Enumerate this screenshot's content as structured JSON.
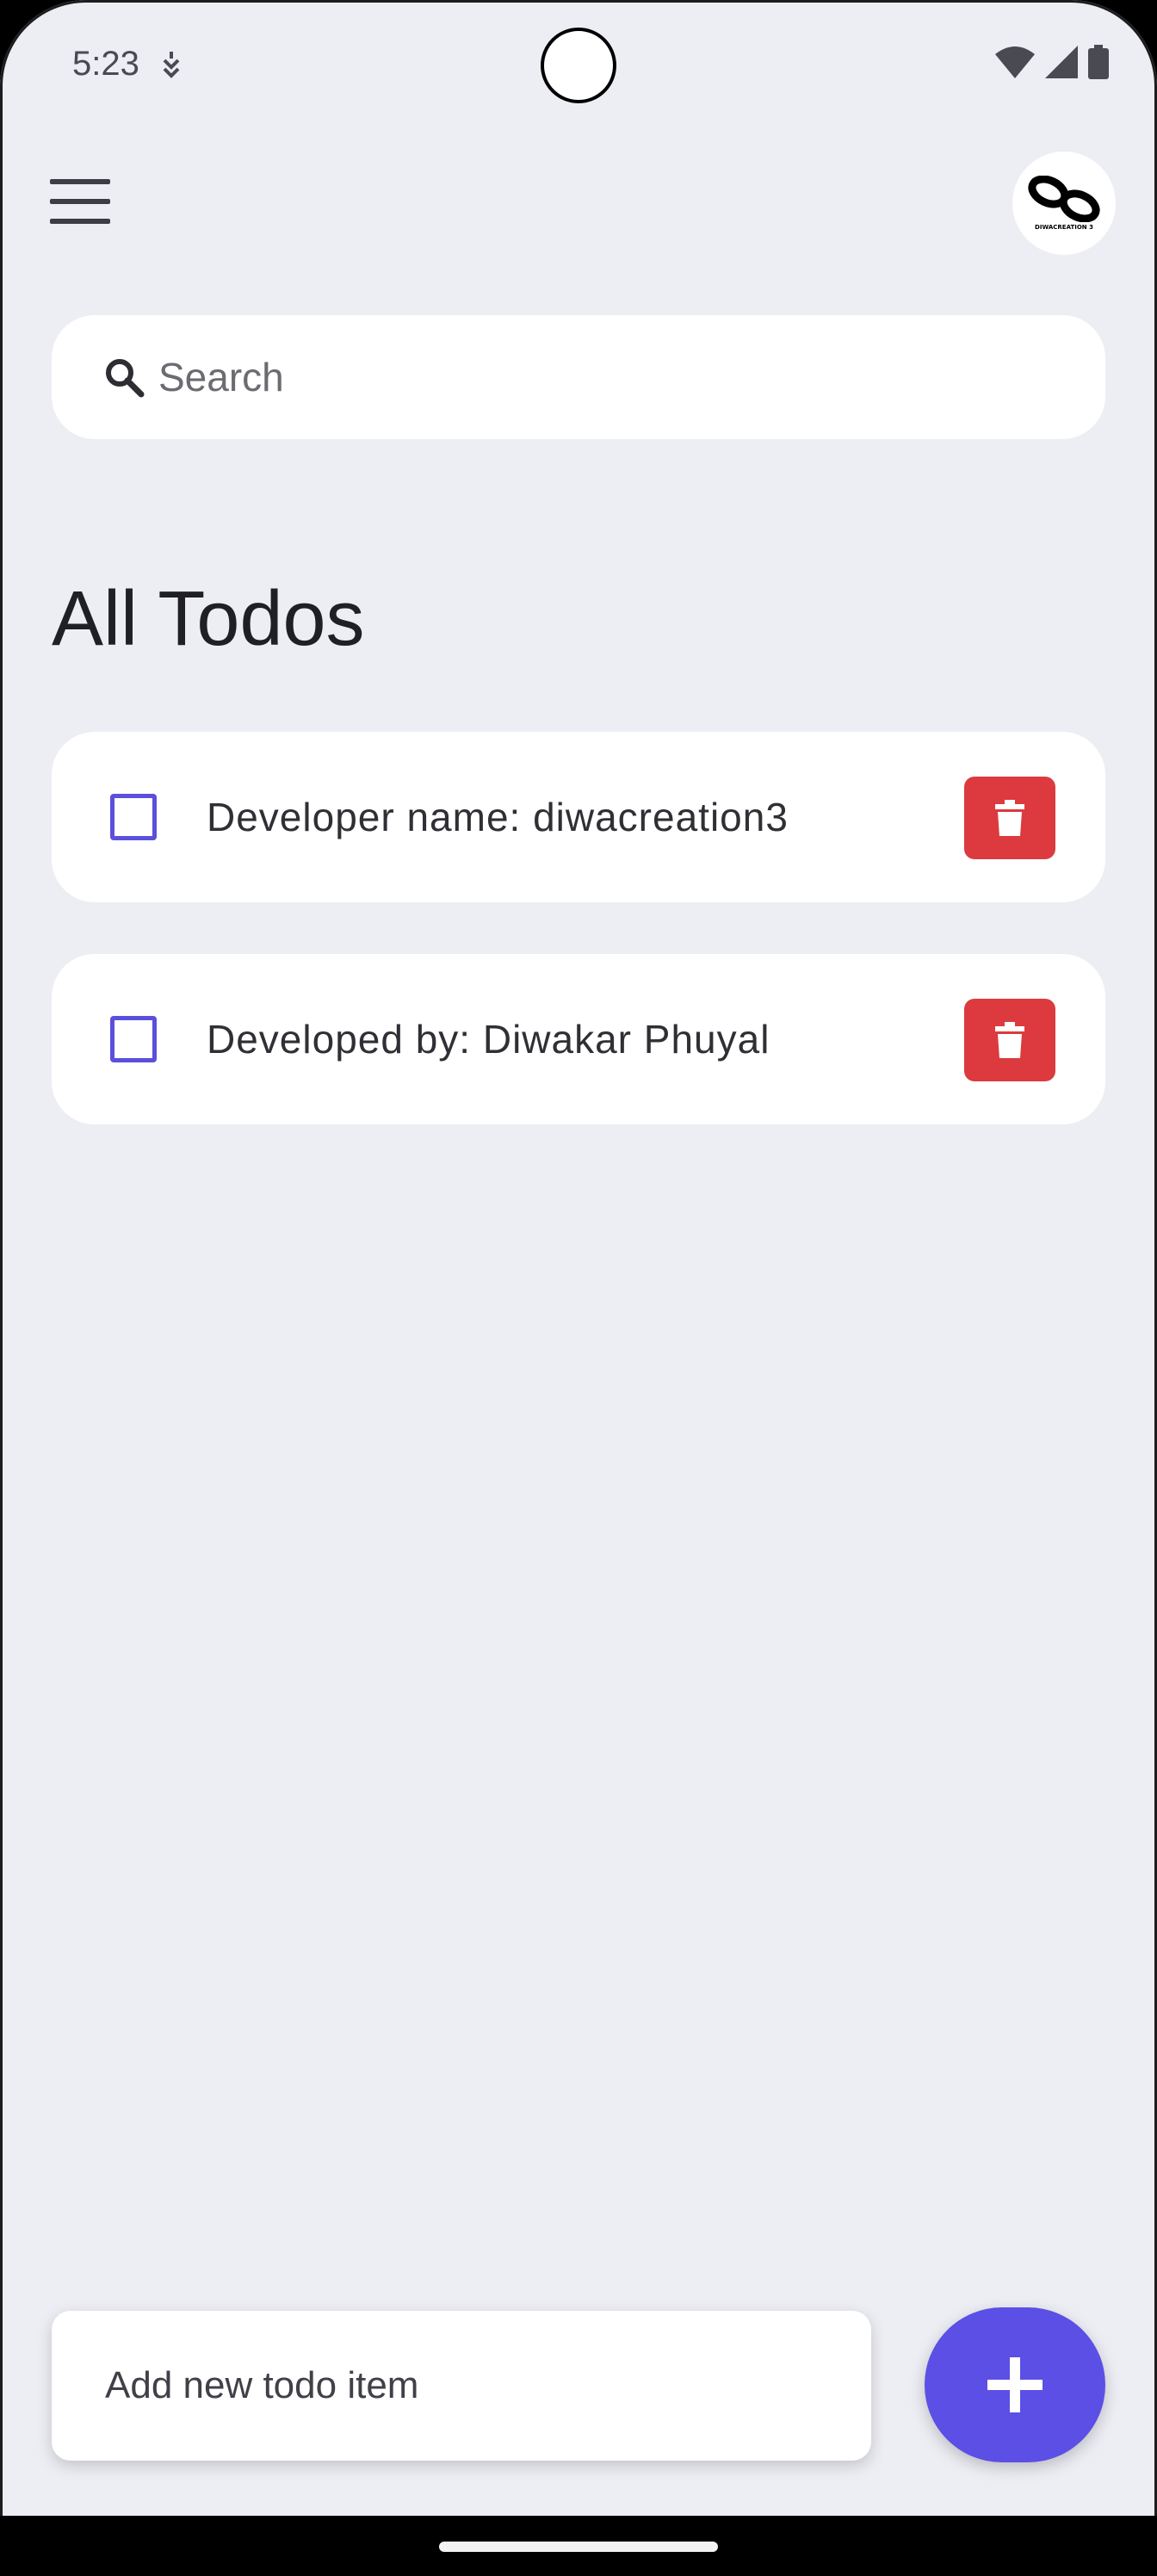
{
  "status_bar": {
    "time": "5:23",
    "icons": [
      "notification-icon",
      "wifi-icon",
      "signal-icon",
      "battery-icon"
    ]
  },
  "app_bar": {
    "menu_icon": "menu-icon",
    "avatar_logo_text": "DIWACREATION 3"
  },
  "search": {
    "placeholder": "Search",
    "value": "",
    "icon": "search-icon"
  },
  "main": {
    "title": "All Todos",
    "todos": [
      {
        "text": "Developer name: diwacreation3",
        "checked": false
      },
      {
        "text": "Developed by: Diwakar Phuyal",
        "checked": false
      }
    ]
  },
  "add_todo": {
    "placeholder": "Add new todo item",
    "value": "",
    "button_icon": "plus-icon"
  },
  "colors": {
    "background": "#edeef4",
    "accent": "#5b4fe6",
    "delete": "#dc3a3e",
    "card": "#ffffff"
  }
}
